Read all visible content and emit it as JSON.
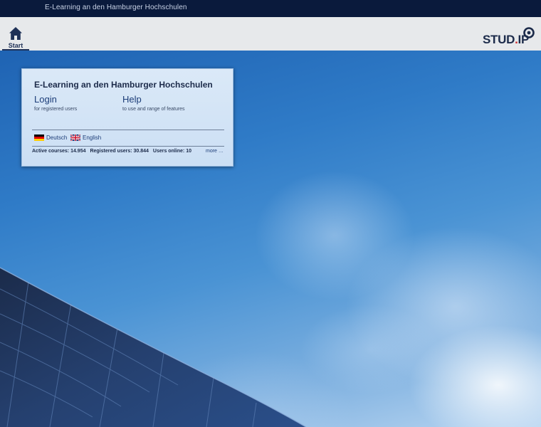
{
  "topbar": {
    "title": "E-Learning an den Hamburger Hochschulen"
  },
  "nav": {
    "start_label": "Start",
    "home_icon": "home-icon"
  },
  "logo": {
    "text_main": "STUD",
    "text_dot": ".",
    "text_end": "IP",
    "accent": "#cf2e2e"
  },
  "panel": {
    "title": "E-Learning an den Hamburger Hochschulen",
    "login": {
      "label": "Login",
      "subtitle": "for registered users"
    },
    "help": {
      "label": "Help",
      "subtitle": "to use and range of features"
    },
    "languages": [
      {
        "label": "Deutsch",
        "icon": "german-flag-icon"
      },
      {
        "label": "English",
        "icon": "uk-flag-icon"
      }
    ],
    "stats": {
      "active_courses": "Active courses: 14.954",
      "registered_users": "Registered users: 30.844",
      "users_online": "Users online: 10"
    },
    "more": "more …"
  },
  "colors": {
    "topbar": "#0a1a3c",
    "navbar": "#e7e9eb",
    "link": "#1c3d78"
  }
}
